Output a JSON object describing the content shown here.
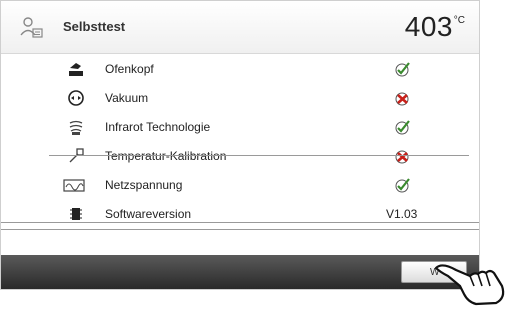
{
  "header": {
    "title": "Selbsttest",
    "temperature": "403",
    "unit": "°C",
    "icon": "user-icon"
  },
  "checks": [
    {
      "label": "Ofenkopf",
      "icon": "furnace-head-icon",
      "status": "ok"
    },
    {
      "label": "Vakuum",
      "icon": "vacuum-pump-icon",
      "status": "error"
    },
    {
      "label": "Infrarot Technologie",
      "icon": "infrared-icon",
      "status": "ok"
    },
    {
      "label": "Temperatur-Kalibration",
      "icon": "calibration-probe-icon",
      "status": "error"
    },
    {
      "label": "Netzspannung",
      "icon": "mains-voltage-icon",
      "status": "ok"
    }
  ],
  "software": {
    "label": "Softwareversion",
    "icon": "chip-icon",
    "value": "V1.03"
  },
  "bottombar": {
    "button_label": "W"
  },
  "colors": {
    "ok": "#3a8a2e",
    "error": "#c8201a",
    "bar": "#3a3a3a"
  }
}
